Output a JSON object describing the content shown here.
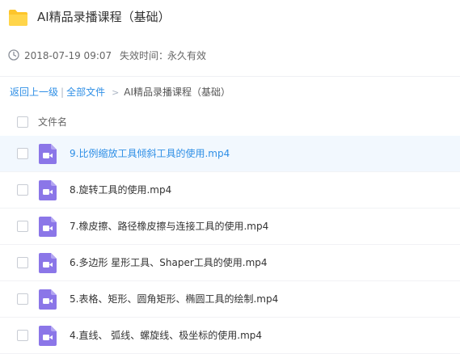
{
  "header": {
    "title": "AI精品录播课程（基础）",
    "icon": "folder-icon",
    "folder_color": "#fdc52b"
  },
  "meta": {
    "clock_icon": "clock-icon",
    "date": "2018-07-19 09:07",
    "expire_label": "失效时间：",
    "expire_value": "永久有效"
  },
  "breadcrumb": {
    "back": "返回上一级",
    "separator": "|",
    "all_files": "全部文件",
    "arrow": ">",
    "current": "AI精品录播课程（基础）",
    "link_color": "#2f8fe6"
  },
  "list": {
    "column_name": "文件名",
    "video_icon_color": "#8b76e8",
    "active_row_color": "#f2f8fe",
    "files": [
      {
        "name": "9.比例缩放工具倾斜工具的使用.mp4",
        "icon": "video-file-icon",
        "active": true
      },
      {
        "name": "8.旋转工具的使用.mp4",
        "icon": "video-file-icon",
        "active": false
      },
      {
        "name": "7.橡皮擦、路径橡皮擦与连接工具的使用.mp4",
        "icon": "video-file-icon",
        "active": false
      },
      {
        "name": "6.多边形 星形工具、Shaper工具的使用.mp4",
        "icon": "video-file-icon",
        "active": false
      },
      {
        "name": "5.表格、矩形、圆角矩形、椭圆工具的绘制.mp4",
        "icon": "video-file-icon",
        "active": false
      },
      {
        "name": "4.直线、 弧线、螺旋线、极坐标的使用.mp4",
        "icon": "video-file-icon",
        "active": false
      }
    ]
  }
}
